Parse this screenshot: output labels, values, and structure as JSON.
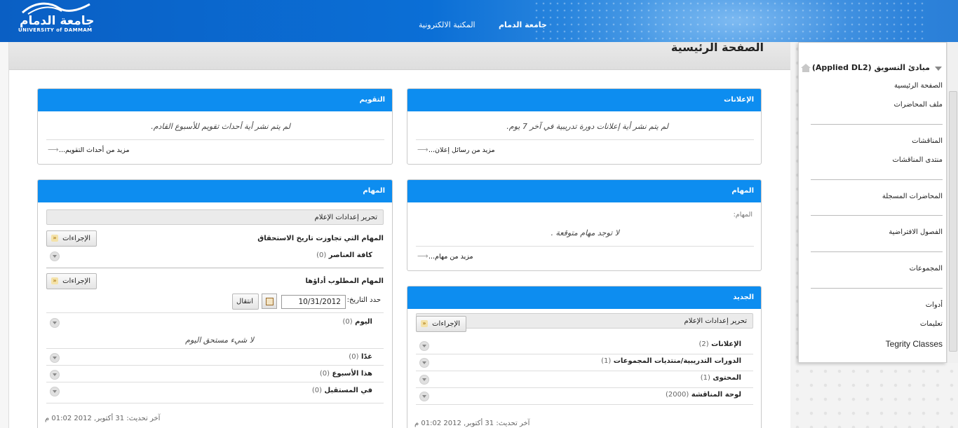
{
  "header": {
    "logo_arabic": "جامعة الدمام",
    "logo_english": "UNIVERSITY of DAMMAM",
    "nav": [
      "جامعة الدمام",
      "المكتبة الالكترونية"
    ]
  },
  "page_title": "الصفحة الرئيسية",
  "sidebar": {
    "course_title": "مبادئ التسويق (Applied DL2)",
    "items": [
      "الصفحة الرئيسية",
      "ملف المحاضرات",
      "المناقشات",
      "منتدى المناقشات",
      "المحاضرات المسجلة",
      "الفصول الافتراضية",
      "المجموعات",
      "أدوات",
      "تعليمات",
      "Tegrity Classes"
    ]
  },
  "announcements": {
    "title": "الإعلانات",
    "message": "لم يتم نشر أية إعلانات دورة تدريبية في آخر 7 يوم.",
    "more_link": "مزيد من رسائل إعلان..."
  },
  "calendar": {
    "title": "التقويم",
    "message": "لم يتم نشر أية أحداث تقويم للأسبوع القادم.",
    "more_link": "مزيد من أحداث التقويم..."
  },
  "tasks_small": {
    "title": "المهام",
    "label": "المهام:",
    "message": "لا توجد مهام متوقعة .",
    "more_link": "مزيد من مهام..."
  },
  "whats_new": {
    "title": "الجديد",
    "edit_notifications": "تحرير إعدادات الإعلام",
    "actions_label": "الإجراءات",
    "rows": [
      {
        "label": "الإعلانات",
        "count": "(2)"
      },
      {
        "label": "الدورات التدريبية/منتديات المجموعات",
        "count": "(1)"
      },
      {
        "label": "المحتوى",
        "count": "(1)"
      },
      {
        "label": "لوحة المناقشة",
        "count": "(2000)"
      }
    ],
    "updated": "آخر تحديث: 31 أكتوبر, 2012 01:02 م"
  },
  "tasks_big": {
    "title": "المهام",
    "edit_notifications": "تحرير إعدادات الإعلام",
    "overdue_heading": "المهام التي تجاوزت تاريخ الاستحقاق",
    "actions_label": "الإجراءات",
    "all_items": {
      "label": "كافة العناصر",
      "count": "(0)"
    },
    "required_heading": "المهام المطلوب أداؤها",
    "date_label": "حدد التاريخ:",
    "date_value": "10/31/2012",
    "go_button": "انتقال",
    "today": {
      "label": "اليوم",
      "count": "(0)"
    },
    "nothing_today": "لا شيء مستحق اليوم",
    "tomorrow": {
      "label": "غدًا",
      "count": "(0)"
    },
    "this_week": {
      "label": "هذا الأسبوع",
      "count": "(0)"
    },
    "future": {
      "label": "في المستقبل",
      "count": "(0)"
    },
    "updated": "آخر تحديث: 31 أكتوبر, 2012 01:02 م"
  }
}
